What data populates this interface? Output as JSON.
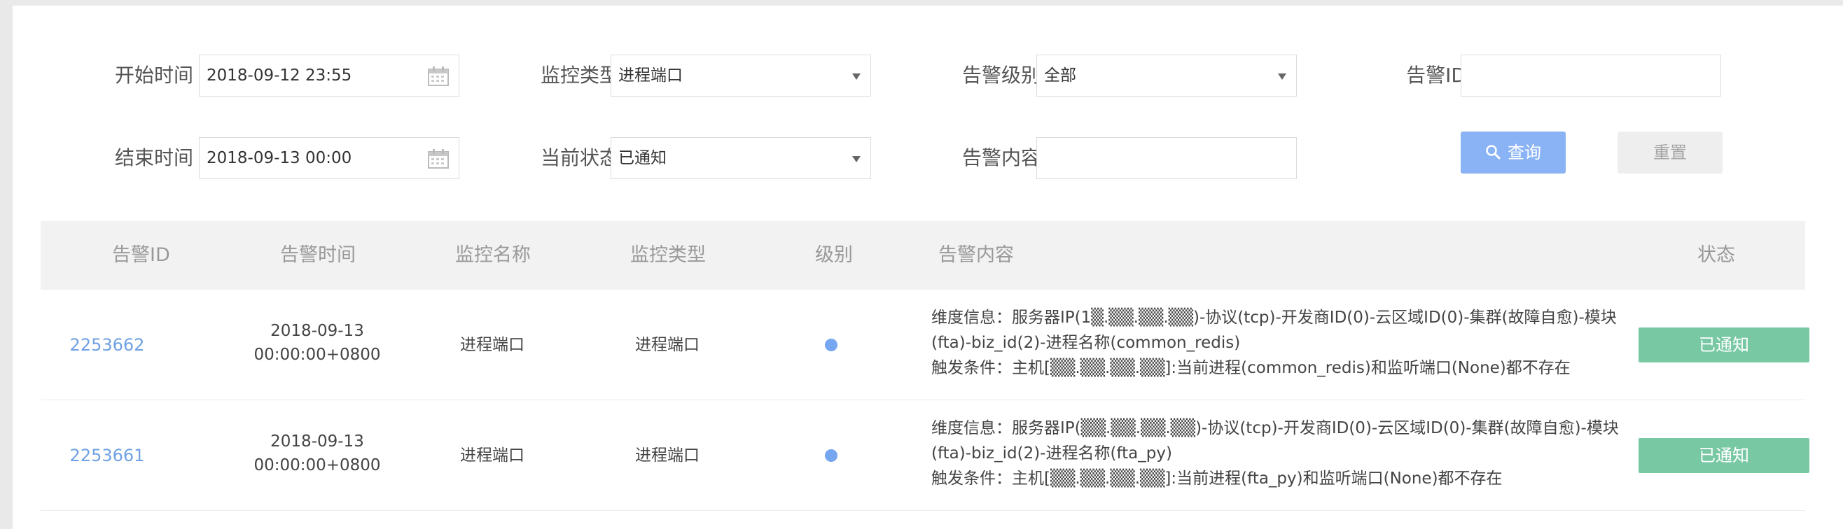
{
  "filters": {
    "start_time": {
      "label": "开始时间",
      "value": "2018-09-12 23:55"
    },
    "end_time": {
      "label": "结束时间",
      "value": "2018-09-13 00:00"
    },
    "monitor_type": {
      "label": "监控类型",
      "value": "进程端口"
    },
    "current_state": {
      "label": "当前状态",
      "value": "已通知"
    },
    "alert_level": {
      "label": "告警级别",
      "value": "全部"
    },
    "alert_content": {
      "label": "告警内容",
      "value": ""
    },
    "alert_id": {
      "label": "告警ID",
      "value": ""
    },
    "query_label": "查询",
    "reset_label": "重置"
  },
  "table": {
    "columns": [
      "告警ID",
      "告警时间",
      "监控名称",
      "监控类型",
      "级别",
      "告警内容",
      "状态"
    ],
    "rows": [
      {
        "id": "2253662",
        "time_date": "2018-09-13",
        "time_clock": "00:00:00+0800",
        "monitor_name": "进程端口",
        "monitor_type": "进程端口",
        "content_line1": "维度信息：服务器IP(1▒.▒▒.▒▒.▒▒)-协议(tcp)-开发商ID(0)-云区域ID(0)-集群(故障自愈)-模块",
        "content_line2": "(fta)-biz_id(2)-进程名称(common_redis)",
        "content_line3": "触发条件：主机[▒▒.▒▒.▒▒.▒▒]:当前进程(common_redis)和监听端口(None)都不存在",
        "status": "已通知"
      },
      {
        "id": "2253661",
        "time_date": "2018-09-13",
        "time_clock": "00:00:00+0800",
        "monitor_name": "进程端口",
        "monitor_type": "进程端口",
        "content_line1": "维度信息：服务器IP(▒▒.▒▒.▒▒.▒▒)-协议(tcp)-开发商ID(0)-云区域ID(0)-集群(故障自愈)-模块",
        "content_line2": "(fta)-biz_id(2)-进程名称(fta_py)",
        "content_line3": "触发条件：主机[▒▒.▒▒.▒▒.▒▒]:当前进程(fta_py)和监听端口(None)都不存在",
        "status": "已通知"
      }
    ]
  },
  "colors": {
    "accent_blue": "#6fa1e3",
    "query_button": "#89b3f4",
    "status_green": "#79c8a4",
    "level_dot": "#76a6ef"
  }
}
